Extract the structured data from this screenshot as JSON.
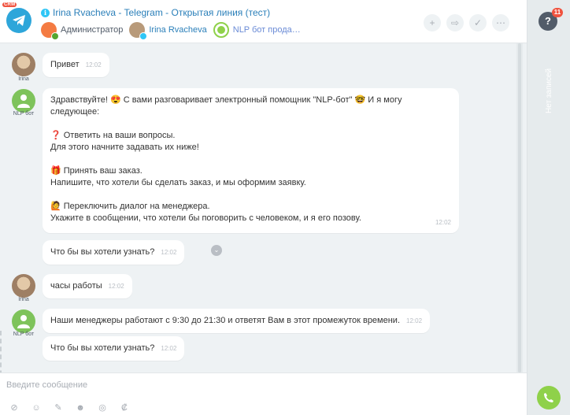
{
  "header": {
    "badge": "CRM",
    "title": "Irina Rvacheva - Telegram - Открытая линия (тест)",
    "participants": [
      {
        "label": "Администратор"
      },
      {
        "label": "Irina Rvacheva"
      },
      {
        "label": "NLP бот прода…"
      }
    ],
    "actions": [
      "add-icon",
      "forward-icon",
      "done-icon",
      "more-icon"
    ]
  },
  "messages": [
    {
      "author": "Irina",
      "text": "Привет",
      "time": "12:02"
    },
    {
      "author": "NLP бот",
      "lines": [
        "Здравствуйте! 😍 С вами разговаривает электронный помощник \"NLP-бот\" 🤓 И я могу",
        "следующее:",
        "",
        "❓ Ответить на ваши вопросы.",
        "Для этого начните задавать их ниже!",
        "",
        "🎁 Принять ваш заказ.",
        "Напишите, что хотели бы сделать заказ, и мы оформим заявку.",
        "",
        "🙋 Переключить диалог на менеджера.",
        "Укажите в сообщении, что хотели бы поговорить с человеком, и я его позову."
      ],
      "time": "12:02"
    },
    {
      "author": "",
      "text": "Что бы вы хотели узнать?",
      "time": "12:02"
    },
    {
      "author": "Irina",
      "text": "часы работы",
      "time": "12:02"
    },
    {
      "author": "NLP бот",
      "text": "Наши менеджеры работают с 9:30 до 21:30 и ответят Вам в этот промежуток времени.",
      "time": "12:02"
    },
    {
      "author": "",
      "text": "Что бы вы хотели узнать?",
      "time": "12:02"
    }
  ],
  "composer": {
    "placeholder": "Введите сообщение",
    "tools": [
      "attach-icon",
      "user-icon",
      "edit-icon",
      "smile-icon",
      "hide-icon",
      "currency-icon"
    ]
  },
  "rightbar": {
    "help": "?",
    "badge_count": "11",
    "vertical_label": "Нет записей"
  }
}
